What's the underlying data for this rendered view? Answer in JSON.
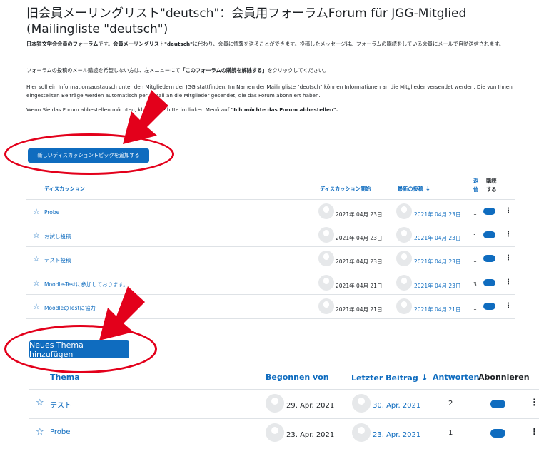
{
  "page_title": "旧会員メーリングリスト\"deutsch\"：会員用フォーラムForum für JGG-Mitglied (Mailingliste \"deutsch\")",
  "intro": {
    "p1_bold1": "日本独文学会会員のフォーラム",
    "p1_text1": "です。",
    "p1_bold2": "会員メーリングリスト\"deutsch\"",
    "p1_text2": "に代わり、会員に情報を送ることができます。投稿したメッセージは、フォーラムの購読をしている会員にメールで自動送信されます。",
    "p2_text1": "フォーラムの投稿のメール購読を希望しない方は、左メニューにて",
    "p2_bold": "「このフォーラムの購読を解除する」",
    "p2_text2": "をクリックしてください。",
    "p3": "Hier soll ein Informationsaustausch unter den Mitgliedern der JGG stattfinden. Im Namen der Mailingliste \"deutsch\" können Informationen an die Mitglieder versendet werden. Die von Ihnen eingestellten Beiträge werden automatisch per E-Mail an die Mitglieder gesendet, die das Forum abonniert haben.",
    "p4_text": "Wenn Sie das Forum abbestellen möchten, klicken Sie bitte im linken Menü auf",
    "p4_bold": "\"Ich möchte das Forum abbestellen\"."
  },
  "jp_forum": {
    "add_button": "新しいディスカッショントピックを追加する",
    "headers": {
      "discussion": "ディスカッション",
      "started": "ディスカッション開始",
      "latest": "最新の投稿",
      "replies_1": "返",
      "replies_2": "信",
      "subscribe_1": "購読",
      "subscribe_2": "する"
    },
    "rows": [
      {
        "title": "Probe",
        "started": "2021年 04月 23日",
        "latest": "2021年 04月 23日",
        "replies": "1"
      },
      {
        "title": "お試し投稿",
        "started": "2021年 04月 23日",
        "latest": "2021年 04月 23日",
        "replies": "1"
      },
      {
        "title": "テスト投稿",
        "started": "2021年 04月 23日",
        "latest": "2021年 04月 23日",
        "replies": "1"
      },
      {
        "title": "Moodle-Testに参加しております。",
        "started": "2021年 04月 21日",
        "latest": "2021年 04月 23日",
        "replies": "3"
      },
      {
        "title": "MoodleのTestに協力",
        "started": "2021年 04月 21日",
        "latest": "2021年 04月 21日",
        "replies": "1"
      }
    ]
  },
  "de_forum": {
    "add_button": "Neues Thema hinzufügen",
    "headers": {
      "thema": "Thema",
      "started": "Begonnen von",
      "latest": "Letzter Beitrag",
      "replies": "Antworten",
      "subscribe": "Abonnieren"
    },
    "rows": [
      {
        "title": "テスト",
        "started": "29. Apr. 2021",
        "latest": "30. Apr. 2021",
        "replies": "2"
      },
      {
        "title": "Probe",
        "started": "23. Apr. 2021",
        "latest": "23. Apr. 2021",
        "replies": "1"
      }
    ]
  },
  "icons": {
    "star": "☆",
    "sort_down": "↓",
    "menu": "⋮"
  },
  "colors": {
    "primary": "#0f6cbf",
    "annotation_red": "#e3001b"
  }
}
